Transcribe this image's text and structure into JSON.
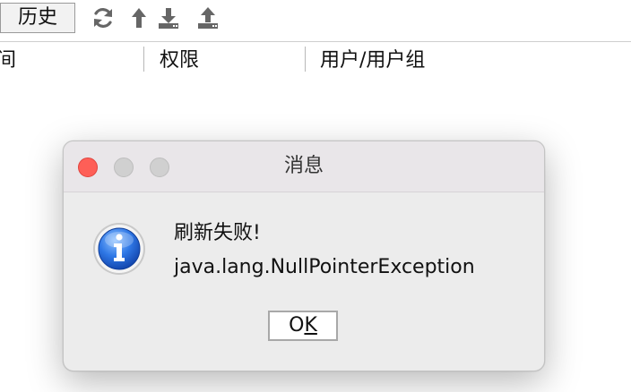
{
  "toolbar": {
    "history_label": "历史",
    "icons": [
      "refresh-icon",
      "upload-arrow-icon",
      "download-icon",
      "upload-icon"
    ]
  },
  "table": {
    "headers": [
      "间",
      "权限",
      "用户/用户组"
    ]
  },
  "dialog": {
    "title": "消息",
    "message_line1": "刷新失败!",
    "message_line2": "java.lang.NullPointerException",
    "ok_label_prefix": "O",
    "ok_label_mnemonic": "K",
    "icon": "info-icon"
  },
  "colors": {
    "close_button": "#fe5f57",
    "inactive_traffic": "#d0d0d0",
    "info_blue": "#1b5fd6"
  }
}
